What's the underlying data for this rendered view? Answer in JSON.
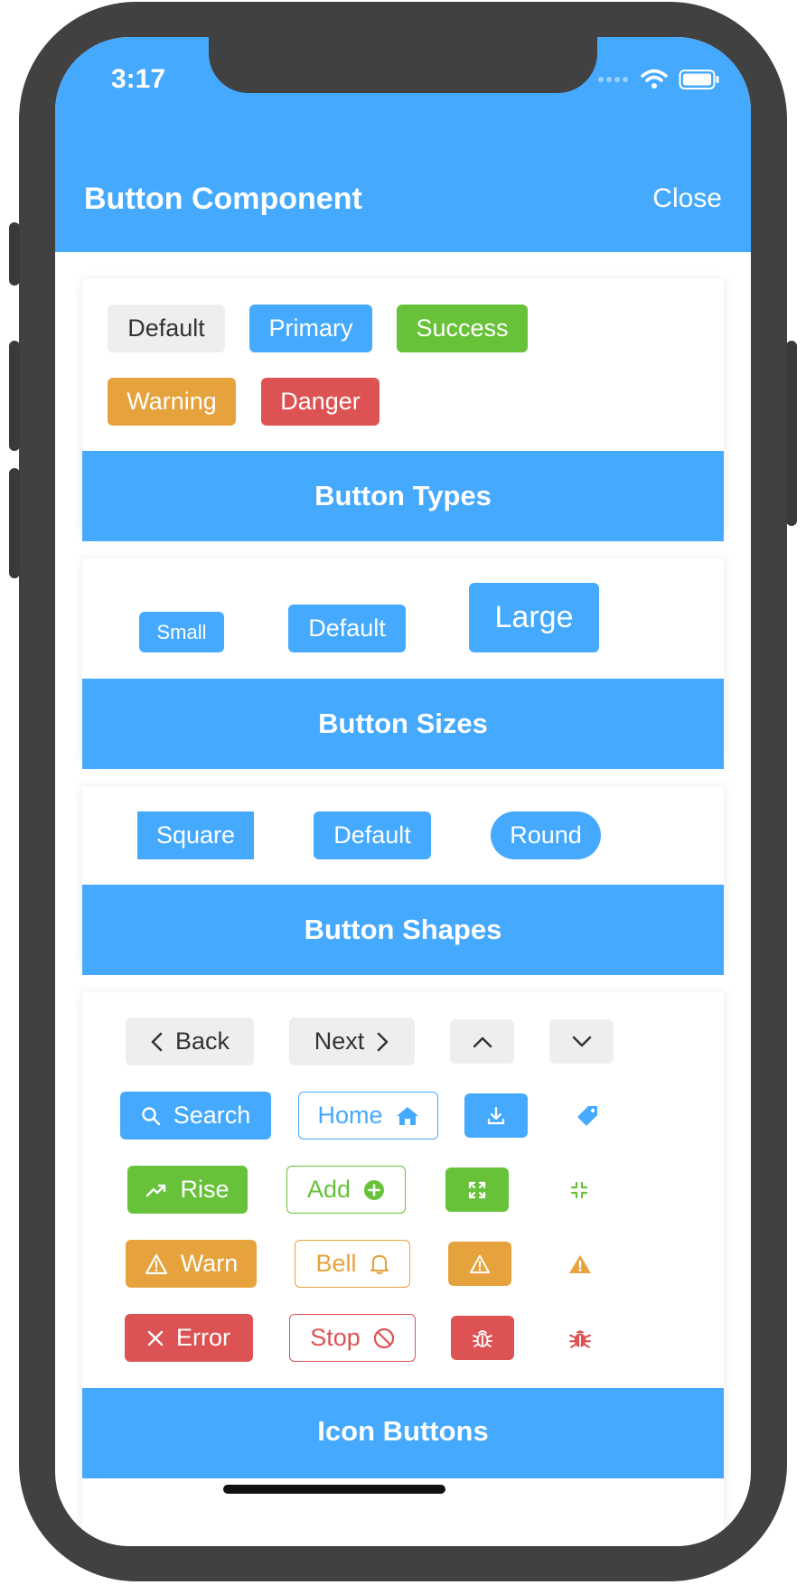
{
  "status": {
    "time": "3:17"
  },
  "nav": {
    "title": "Button Component",
    "close": "Close"
  },
  "types": {
    "default": "Default",
    "primary": "Primary",
    "success": "Success",
    "warning": "Warning",
    "danger": "Danger",
    "footer": "Button Types"
  },
  "sizes": {
    "small": "Small",
    "default": "Default",
    "large": "Large",
    "footer": "Button Sizes"
  },
  "shapes": {
    "square": "Square",
    "default": "Default",
    "round": "Round",
    "footer": "Button Shapes"
  },
  "icons": {
    "back": "Back",
    "next": "Next",
    "search": "Search",
    "home": "Home",
    "rise": "Rise",
    "add": "Add",
    "warn": "Warn",
    "bell": "Bell",
    "error": "Error",
    "stop": "Stop",
    "footer": "Icon Buttons"
  },
  "colors": {
    "primary": "#45a9fe",
    "success": "#67c23a",
    "warning": "#e6a23c",
    "danger": "#dd5353",
    "default": "#eeeeee"
  }
}
